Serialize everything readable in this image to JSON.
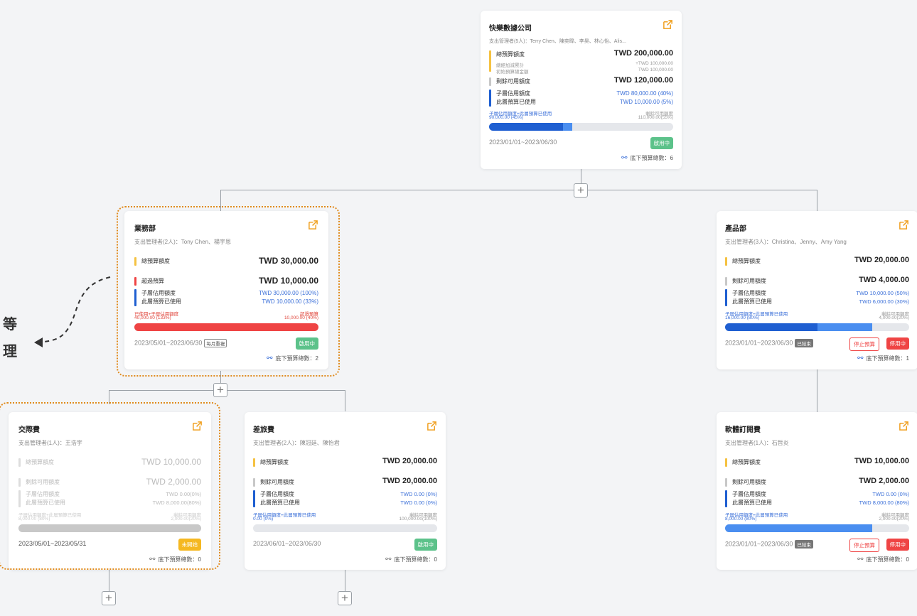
{
  "root": {
    "title": "快樂數據公司",
    "managers": "支出管理者(5人)：Terry Chen、陳奕暐、李昊、林心怡、Alis...",
    "total_label": "總預算額度",
    "total_value": "TWD 200,000.00",
    "sub1_label": "總經加減累計",
    "sub1_value": "+TWD 100,000.00",
    "sub2_label": "初始預算總金額",
    "sub2_value": "TWD 100,000.00",
    "remain_label": "剩餘可用額度",
    "remain_value": "TWD 120,000.00",
    "child_label": "子層佔用額度",
    "child_value": "TWD 80,000.00 (40%)",
    "used_label": "此層預算已使用",
    "used_value": "TWD 10,000.00 (5%)",
    "foot_left1": "子層佔用額度+此層預算已使用",
    "foot_left2": "90,000.00 (45%)",
    "foot_right1": "剩餘可用額度",
    "foot_right2": "110,000.00(55%)",
    "progress_primary": 0.4,
    "progress_secondary": 0.05,
    "date": "2023/01/01~2023/06/30",
    "status": "啟用中",
    "count": "底下預算總數：6"
  },
  "sales": {
    "title": "業務部",
    "managers": "支出管理者(2人)：Tony Chen、楊宇恩",
    "total_label": "總預算額度",
    "total_value": "TWD 30,000.00",
    "over_label": "超過預算",
    "over_value": "TWD 10,000.00",
    "child_label": "子層佔用額度",
    "child_value": "TWD 30,000.00 (100%)",
    "used_label": "此層預算已使用",
    "used_value": "TWD 10,000.00 (33%)",
    "foot_left1": "已使用+子層佔用額度",
    "foot_left2": "40,000.00 (133%)",
    "foot_right1": "超過預算",
    "foot_right2": "10,000.00 (40%)",
    "progress_primary": 1.0,
    "date": "2023/05/01~2023/06/30",
    "tag": "每月重複",
    "status": "啟用中",
    "count": "底下預算總數：2"
  },
  "product": {
    "title": "產品部",
    "managers": "支出管理者(3人)：Christina、Jenny、Amy Yang",
    "total_label": "總預算額度",
    "total_value": "TWD 20,000.00",
    "remain_label": "剩餘可用額度",
    "remain_value": "TWD 4,000.00",
    "child_label": "子層佔用額度",
    "child_value": "TWD 10,000.00 (50%)",
    "used_label": "此層預算已使用",
    "used_value": "TWD 6,000.00 (30%)",
    "foot_left1": "子層佔用額度+此層預算已使用",
    "foot_left2": "16,000.00 (80%)",
    "foot_right1": "剩餘可用額度",
    "foot_right2": "4,000.00(20%)",
    "progress_primary": 0.5,
    "progress_secondary": 0.3,
    "date": "2023/01/01~2023/06/30",
    "tag": "已結束",
    "btn_stop": "停止預算",
    "status": "停用中",
    "count": "底下預算總數：1"
  },
  "social": {
    "title": "交際費",
    "managers": "支出管理者(1人)：王浩宇",
    "total_label": "總預算額度",
    "total_value": "TWD 10,000.00",
    "remain_label": "剩餘可用額度",
    "remain_value": "TWD 2,000.00",
    "child_label": "子層佔用額度",
    "child_value": "TWD 0.00(0%)",
    "used_label": "此層預算已使用",
    "used_value": "TWD 8,000.00(80%)",
    "foot_left1": "子層佔用額度+此層預算已使用",
    "foot_left2": "8,000.00 (80%)",
    "foot_right1": "剩餘可用額度",
    "foot_right2": "2,000.00(20%)",
    "progress_primary": 1.0,
    "date": "2023/05/01~2023/05/31",
    "status": "未開始",
    "count": "底下預算總數：0"
  },
  "travel": {
    "title": "差旅費",
    "managers": "支出管理者(2人)：陳冠廷、陳怡君",
    "total_label": "總預算額度",
    "total_value": "TWD 20,000.00",
    "remain_label": "剩餘可用額度",
    "remain_value": "TWD 20,000.00",
    "child_label": "子層佔用額度",
    "child_value": "TWD 0.00 (0%)",
    "used_label": "此層預算已使用",
    "used_value": "TWD 0.00 (0%)",
    "foot_left1": "子層佔用額度+此層預算已使用",
    "foot_left2": "0.00 (0%)",
    "foot_right1": "剩餘可用額度",
    "foot_right2": "100,000.00(100%)",
    "progress_primary": 0.0,
    "date": "2023/06/01~2023/06/30",
    "status": "啟用中",
    "count": "底下預算總數：0"
  },
  "software": {
    "title": "軟體訂閱費",
    "managers": "支出管理者(1人)：石哲炎",
    "total_label": "總預算額度",
    "total_value": "TWD 10,000.00",
    "remain_label": "剩餘可用額度",
    "remain_value": "TWD 2,000.00",
    "child_label": "子層佔用額度",
    "child_value": "TWD 0.00 (0%)",
    "used_label": "此層預算已使用",
    "used_value": "TWD 8,000.00 (80%)",
    "foot_left1": "子層佔用額度+此層預算已使用",
    "foot_left2": "8,000.00 (80%)",
    "foot_right1": "剩餘可用額度",
    "foot_right2": "2,000.00(20%)",
    "progress_primary": 0.8,
    "date": "2023/01/01~2023/06/30",
    "tag": "已結束",
    "btn_stop": "停止預算",
    "status": "停用中",
    "count": "底下預算總數：0"
  },
  "side_text": {
    "line1": "等",
    "line2": "理"
  },
  "colors": {
    "yellow": "#f5c242",
    "blue": "#1f5fd1",
    "blue_light": "#4a8ef0",
    "red": "#ef4444",
    "gray": "#c8c8c8",
    "green": "#5cc28a",
    "orange": "#f0a020",
    "dotted": "#e08a1c"
  }
}
